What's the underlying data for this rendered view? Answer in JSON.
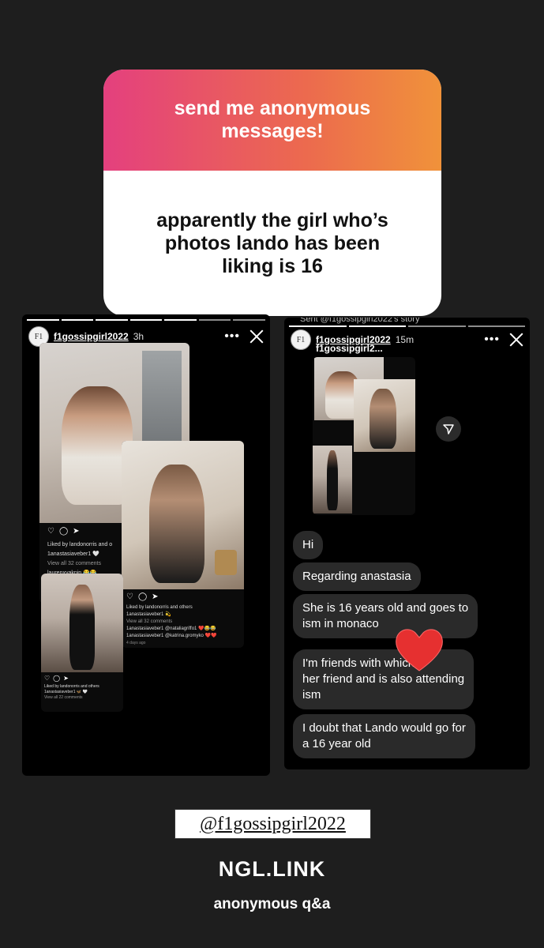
{
  "ngl_card": {
    "prompt": "send me anonymous\nmessages!",
    "answer": "apparently the girl who’s\nphotos lando has been\nliking is 16"
  },
  "left_story": {
    "username": "f1gossipgirl2022",
    "age": "3h",
    "post1": {
      "liked_by": "Liked by landonorris and o",
      "caption_user": "1anastasiaveber1 🤍",
      "view_comments": "View all 32 comments",
      "comment_user": "laurenxvaknin 😂😂"
    },
    "post2": {
      "liked_by": "Liked by landonorris and others",
      "caption_user": "1anastasiaveber1 💫",
      "view_comments": "View all 32 comments",
      "comment1": "1anastasiaveber1 @nataliagriffo1 ❤️😂😂",
      "comment2": "1anastasiaveber1 @katrina.gromyko ❤️❤️",
      "time": "4 days ago"
    },
    "post3": {
      "liked_by": "Liked by landonorris and others",
      "caption_user": "1anastasiaveber1 🦋 🤍",
      "view_comments": "View all 22 comments"
    }
  },
  "right_story": {
    "sent_label": "Sent @f1gossipgirl2022's story",
    "username": "f1gossipgirl2022",
    "age": "15m",
    "preview_name": "f1gossipgirl2...",
    "messages": [
      "Hi",
      "Regarding anastasia",
      "She is 16 years old and goes to\nism in monaco",
      "I'm friends with        which is\nher friend and is also attending\nism",
      "I doubt that Lando would go for\na 16 year old"
    ]
  },
  "footer": {
    "handle": "@f1gossipgirl2022",
    "site": "NGL.LINK",
    "tagline": "anonymous q&a"
  },
  "colors": {
    "background": "#1e1e1e",
    "gradient_start": "#e4407e",
    "gradient_end": "#f0923a",
    "bubble": "#2a2a2a",
    "heart": "#e63030"
  },
  "icons": [
    "more-dots-icon",
    "close-icon",
    "heart-icon",
    "comment-icon",
    "send-icon",
    "heart-sticker"
  ]
}
